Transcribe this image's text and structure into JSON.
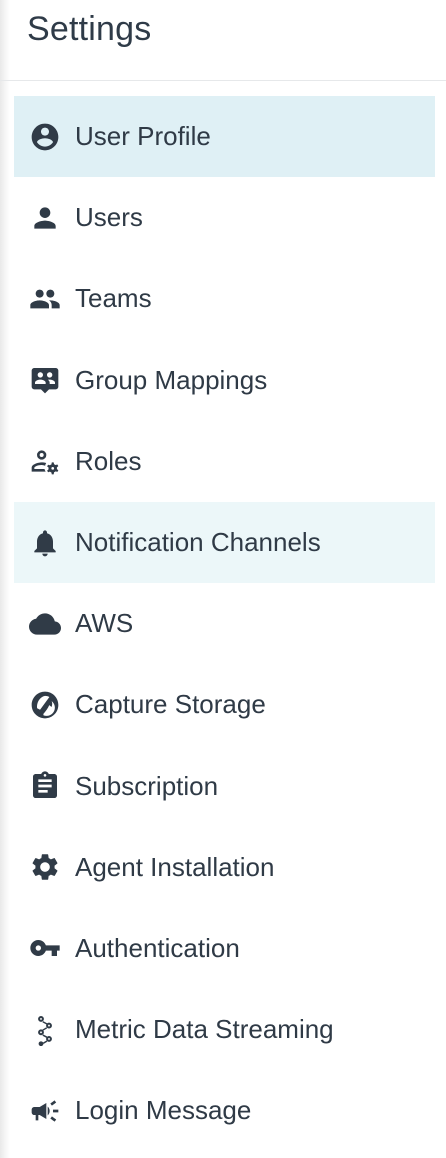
{
  "header": {
    "title": "Settings"
  },
  "nav": {
    "items": [
      {
        "label": "User Profile",
        "icon": "account-circle-icon",
        "state": "selected"
      },
      {
        "label": "Users",
        "icon": "person-icon"
      },
      {
        "label": "Teams",
        "icon": "people-icon"
      },
      {
        "label": "Group Mappings",
        "icon": "group-mapping-icon"
      },
      {
        "label": "Roles",
        "icon": "user-gear-icon"
      },
      {
        "label": "Notification Channels",
        "icon": "bell-icon",
        "state": "hover"
      },
      {
        "label": "AWS",
        "icon": "cloud-icon"
      },
      {
        "label": "Capture Storage",
        "icon": "storage-icon"
      },
      {
        "label": "Subscription",
        "icon": "clipboard-icon"
      },
      {
        "label": "Agent Installation",
        "icon": "gear-icon"
      },
      {
        "label": "Authentication",
        "icon": "key-icon"
      },
      {
        "label": "Metric Data Streaming",
        "icon": "streaming-icon"
      },
      {
        "label": "Login Message",
        "icon": "megaphone-icon"
      }
    ]
  },
  "colors": {
    "selected_bg": "#dff0f5",
    "hover_bg": "#ecf7f9",
    "text": "#2f3a46",
    "icon": "#303b47"
  }
}
